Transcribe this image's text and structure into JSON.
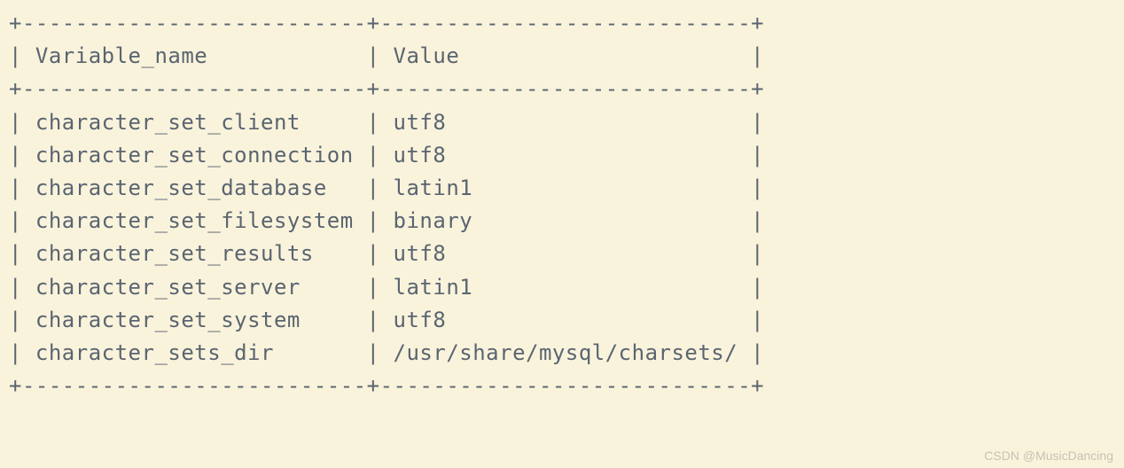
{
  "table": {
    "header": {
      "col1": "Variable_name",
      "col2": "Value"
    },
    "rows": [
      {
        "name": "character_set_client",
        "value": "utf8"
      },
      {
        "name": "character_set_connection",
        "value": "utf8"
      },
      {
        "name": "character_set_database",
        "value": "latin1"
      },
      {
        "name": "character_set_filesystem",
        "value": "binary"
      },
      {
        "name": "character_set_results",
        "value": "utf8"
      },
      {
        "name": "character_set_server",
        "value": "latin1"
      },
      {
        "name": "character_set_system",
        "value": "utf8"
      },
      {
        "name": "character_sets_dir",
        "value": "/usr/share/mysql/charsets/"
      }
    ]
  },
  "watermark": "CSDN @MusicDancing",
  "layout": {
    "col1_width": 26,
    "col2_width": 28
  }
}
